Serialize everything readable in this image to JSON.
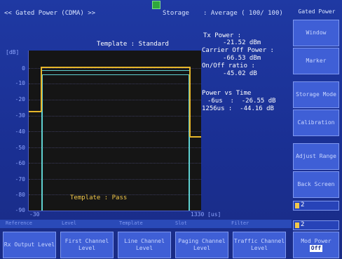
{
  "header": {
    "title": "<< Gated Power (CDMA) >>",
    "storage_label": "Storage",
    "storage_value": ": Average ( 100/ 100)"
  },
  "graph": {
    "unit": "[dB]",
    "y_ticks": [
      "0",
      "-10",
      "-20",
      "-30",
      "-40",
      "-50",
      "-60",
      "-70",
      "-80",
      "-90"
    ],
    "template_title": "Template : Standard",
    "template_result": "Template : Pass",
    "x_start": "-30",
    "x_end": "1330",
    "x_unit": "[us]"
  },
  "measurements": {
    "tx_power_label": "Tx Power :",
    "tx_power_value": "-21.52 dBm",
    "carrier_off_label": "Carrier Off Power :",
    "carrier_off_value": "-66.53 dBm",
    "onoff_label": "On/Off ratio :",
    "onoff_value": "-45.02 dB",
    "pvt_label": "Power vs Time",
    "pvt_row1": "-6us  :  -26.55 dB",
    "pvt_row2": "1256us :  -44.16 dB"
  },
  "right_softkeys": {
    "title": "Gated Power",
    "keys": [
      "Window",
      "Marker",
      "Storage Mode",
      "Calibration",
      "Adjust Range",
      "Back Screen"
    ],
    "index1": "2",
    "index2": "2"
  },
  "status_bar": {
    "items": [
      "Reference",
      "Level",
      "Template",
      "Slot",
      "Filter"
    ]
  },
  "bottom_softkeys": {
    "keys": [
      "Rx Output Level",
      "First Channel Level",
      "Line Channel Level",
      "Paging Channel Level",
      "Traffic Channel Level"
    ],
    "last_key_label": "Mod Power",
    "last_key_state": "Off"
  },
  "colors": {
    "background": "#1a2f8c",
    "plot_bg": "#151515",
    "trace": "#e6b62a",
    "template": "#5fd0d0",
    "softkey": "#3f5fd6"
  }
}
